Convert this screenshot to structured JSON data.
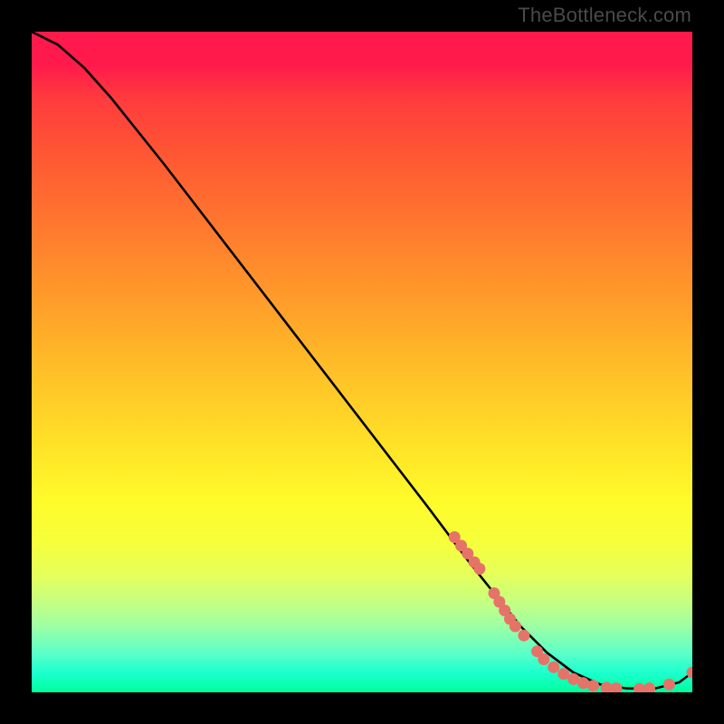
{
  "watermark": "TheBottleneck.com",
  "chart_data": {
    "type": "line",
    "title": "",
    "xlabel": "",
    "ylabel": "",
    "xlim": [
      0,
      100
    ],
    "ylim": [
      0,
      100
    ],
    "series": [
      {
        "name": "curve",
        "x": [
          0,
          4,
          8,
          12,
          20,
          30,
          40,
          50,
          60,
          66,
          70,
          74,
          78,
          82,
          86,
          90,
          94,
          98,
          100
        ],
        "y": [
          100,
          98,
          94.5,
          90,
          80,
          67,
          54,
          41,
          28,
          20,
          15,
          10,
          6,
          3,
          1.2,
          0.6,
          0.5,
          1.5,
          3
        ]
      }
    ],
    "marker_points": {
      "name": "highlight-dots",
      "color": "#e57368",
      "points": [
        {
          "x": 64,
          "y": 23.5
        },
        {
          "x": 65,
          "y": 22.2
        },
        {
          "x": 66,
          "y": 21.0
        },
        {
          "x": 67,
          "y": 19.7
        },
        {
          "x": 67.8,
          "y": 18.7
        },
        {
          "x": 70,
          "y": 15.0
        },
        {
          "x": 70.8,
          "y": 13.7
        },
        {
          "x": 71.6,
          "y": 12.4
        },
        {
          "x": 72.4,
          "y": 11.1
        },
        {
          "x": 73.2,
          "y": 10.0
        },
        {
          "x": 74.5,
          "y": 8.6
        },
        {
          "x": 76.5,
          "y": 6.2
        },
        {
          "x": 77.5,
          "y": 5.0
        },
        {
          "x": 79,
          "y": 3.8
        },
        {
          "x": 80.5,
          "y": 2.8
        },
        {
          "x": 82,
          "y": 2.0
        },
        {
          "x": 83.5,
          "y": 1.4
        },
        {
          "x": 85,
          "y": 1.0
        },
        {
          "x": 87,
          "y": 0.7
        },
        {
          "x": 88.5,
          "y": 0.6
        },
        {
          "x": 92,
          "y": 0.5
        },
        {
          "x": 93.5,
          "y": 0.6
        },
        {
          "x": 96.5,
          "y": 1.2
        },
        {
          "x": 100,
          "y": 3.0
        }
      ]
    },
    "gradient_stops": [
      {
        "pos": 0,
        "color": "#ff1a4b"
      },
      {
        "pos": 18,
        "color": "#ff5534"
      },
      {
        "pos": 40,
        "color": "#ff9a2a"
      },
      {
        "pos": 62,
        "color": "#ffe027"
      },
      {
        "pos": 82,
        "color": "#e6ff5a"
      },
      {
        "pos": 97,
        "color": "#1cffcf"
      },
      {
        "pos": 100,
        "color": "#00ff9c"
      }
    ]
  }
}
